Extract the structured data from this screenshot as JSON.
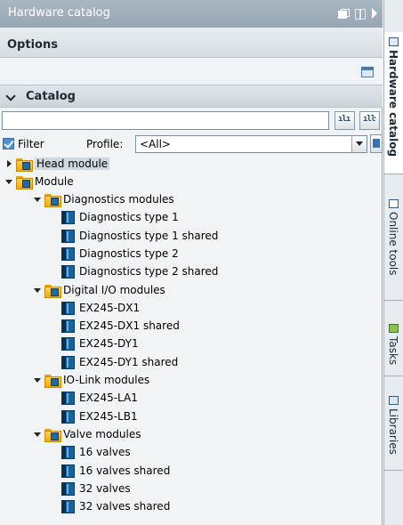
{
  "window": {
    "title": "Hardware catalog"
  },
  "options": {
    "label": "Options"
  },
  "catalog": {
    "label": "Catalog",
    "search": {
      "value": "",
      "placeholder": ""
    },
    "search_down_label": "ılı",
    "search_up_label": "ılŀ",
    "filter": {
      "label": "Filter",
      "checked": true
    },
    "profile": {
      "label": "Profile:",
      "value": "<All>"
    }
  },
  "tree": {
    "head_module": "Head module",
    "module": "Module",
    "diagnostics": {
      "label": "Diagnostics modules",
      "items": [
        "Diagnostics type 1",
        "Diagnostics type 1 shared",
        "Diagnostics type 2",
        "Diagnostics type 2 shared"
      ]
    },
    "digital_io": {
      "label": "Digital I/O modules",
      "items": [
        "EX245-DX1",
        "EX245-DX1 shared",
        "EX245-DY1",
        "EX245-DY1 shared"
      ]
    },
    "io_link": {
      "label": "IO-Link modules",
      "items": [
        "EX245-LA1",
        "EX245-LB1"
      ]
    },
    "valve": {
      "label": "Valve modules",
      "items": [
        "16 valves",
        "16 valves shared",
        "32 valves",
        "32 valves shared"
      ]
    }
  },
  "side_tabs": {
    "hardware": "Hardware catalog",
    "online": "Online tools",
    "tasks": "Tasks",
    "libraries": "Libraries"
  }
}
